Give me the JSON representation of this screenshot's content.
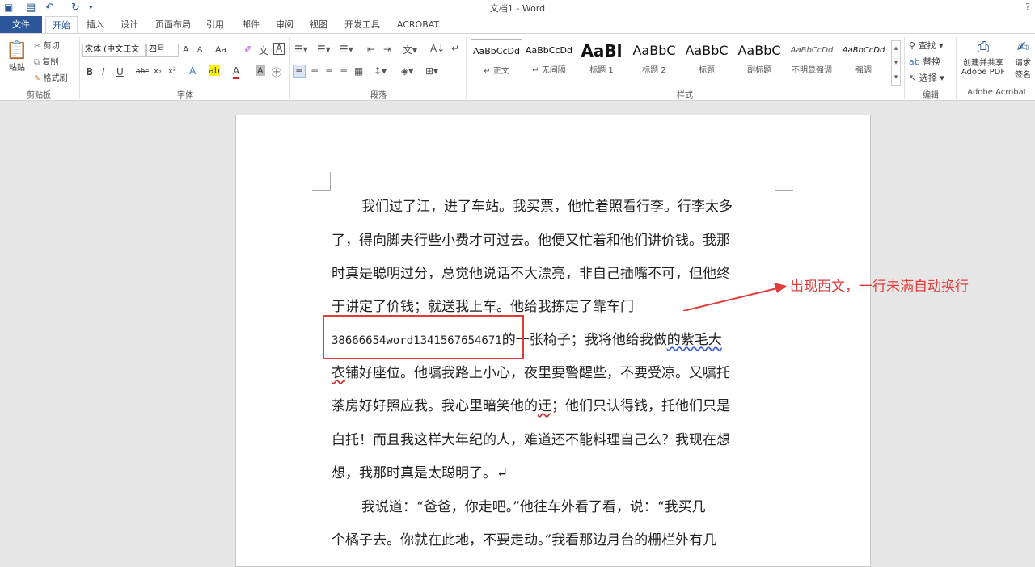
{
  "window": {
    "title": "文档1 - Word",
    "help": "?"
  },
  "tabs": [
    "文件",
    "开始",
    "插入",
    "设计",
    "页面布局",
    "引用",
    "邮件",
    "审阅",
    "视图",
    "开发工具",
    "ACROBAT"
  ],
  "clipboard": {
    "paste": "粘贴",
    "cut": "剪切",
    "copy": "复制",
    "format_painter": "格式刷",
    "label": "剪贴板"
  },
  "font": {
    "name": "宋体 (中文正文",
    "size": "四号",
    "label": "字体",
    "bold": "B",
    "italic": "I",
    "underline": "U",
    "strike": "abc",
    "sub": "x₂",
    "sup": "x²",
    "grow": "A",
    "shrink": "A",
    "case": "Aa"
  },
  "paragraph": {
    "label": "段落"
  },
  "styles": {
    "label": "样式",
    "items": [
      {
        "sample": "AaBbCcDd",
        "name": "↵ 正文"
      },
      {
        "sample": "AaBbCcDd",
        "name": "↵ 无间隔"
      },
      {
        "sample": "AaBl",
        "name": "标题 1"
      },
      {
        "sample": "AaBbC",
        "name": "标题 2"
      },
      {
        "sample": "AaBbC",
        "name": "标题"
      },
      {
        "sample": "AaBbC",
        "name": "副标题"
      },
      {
        "sample": "AaBbCcDd",
        "name": "不明显强调"
      },
      {
        "sample": "AaBbCcDd",
        "name": "强调"
      }
    ]
  },
  "editing": {
    "find": "查找",
    "replace": "替换",
    "select": "选择",
    "label": "编辑"
  },
  "acrobat": {
    "create_line1": "创建并共享",
    "create_line2": "Adobe PDF",
    "request_line1": "请求",
    "request_line2": "签名",
    "label": "Adobe Acrobat"
  },
  "document": {
    "lines": [
      "我们过了江，进了车站。我买票，他忙着照看行李。行李太多",
      "了，得向脚夫行些小费才可过去。他便又忙着和他们讲价钱。我那",
      "时真是聪明过分，总觉他说话不大漂亮，非自己插嘴不可，但他终",
      "于讲定了价钱；就送我上车。他给我拣定了靠车门",
      "38666654word1341567654671",
      "的一张椅子；我将他给我做",
      "的紫毛大",
      "衣",
      "铺好座位。他嘱我路上小心，夜里要警醒些，不要受凉。又嘱托",
      "茶房好好照应我。我心里暗笑他的",
      "迂",
      "；他们只认得钱，托他们只是",
      "白托！而且我这样大年纪的人，难道还不能料理自己么？我现在想",
      "想，我那时真是太聪明了。↵",
      "我说道：“爸爸，你走吧。”他往车外看了看，说：“我买几",
      "个橘子去。你就在此地，不要走动。”我看那边月台的栅栏外有几"
    ]
  },
  "annotation": {
    "text": "出现西文，一行未满自动换行"
  },
  "colors": {
    "word_blue": "#2b579a",
    "annotation_red": "#e23b3b"
  }
}
